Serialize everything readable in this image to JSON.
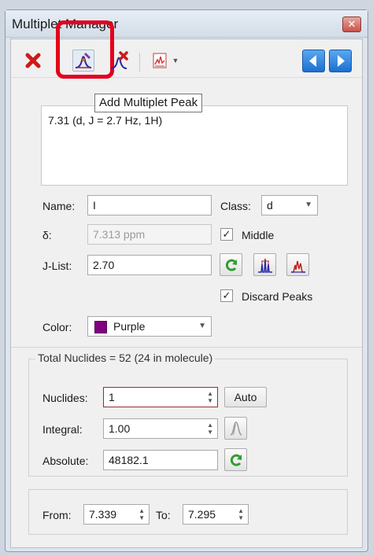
{
  "window": {
    "title": "Multiplet Manager",
    "close_glyph": "✕"
  },
  "toolbar": {
    "buttons": [
      {
        "name": "delete-multiplet",
        "icon": "red-x-icon"
      },
      {
        "name": "add-multiplet-peak",
        "icon": "add-peak-icon",
        "pressed": true
      },
      {
        "name": "remove-multiplet-peak",
        "icon": "remove-peak-icon"
      },
      {
        "name": "report-menu",
        "icon": "report-spectrum-icon"
      },
      {
        "name": "previous",
        "icon": "left-arrow-icon"
      },
      {
        "name": "next",
        "icon": "right-arrow-icon"
      }
    ],
    "tooltip": "Add Multiplet Peak",
    "highlight_color": "#e3001b"
  },
  "report": {
    "text": "7.31 (d, J = 2.7 Hz, 1H)"
  },
  "form": {
    "name_label": "Name:",
    "name_value": "I",
    "class_label": "Class:",
    "class_value": "d",
    "delta_label": "δ:",
    "delta_value": "7.313 ppm",
    "middle_label": "Middle",
    "middle_checked": true,
    "jlist_label": "J-List:",
    "jlist_value": "2.70",
    "discard_label": "Discard Peaks",
    "discard_checked": true,
    "color_label": "Color:",
    "color_value": "Purple",
    "color_hex": "#800080"
  },
  "nuclides": {
    "group_title": "Total Nuclides = 52 (24 in molecule)",
    "nuclides_label": "Nuclides:",
    "nuclides_value": "1",
    "auto_label": "Auto",
    "integral_label": "Integral:",
    "integral_value": "1.00",
    "absolute_label": "Absolute:",
    "absolute_value": "48182.1"
  },
  "range": {
    "from_label": "From:",
    "from_value": "7.339",
    "to_label": "To:",
    "to_value": "7.295"
  },
  "colors": {
    "accent_blue": "#1c6fd0",
    "refresh_green": "#2f9e2f",
    "delete_red": "#d01818"
  }
}
